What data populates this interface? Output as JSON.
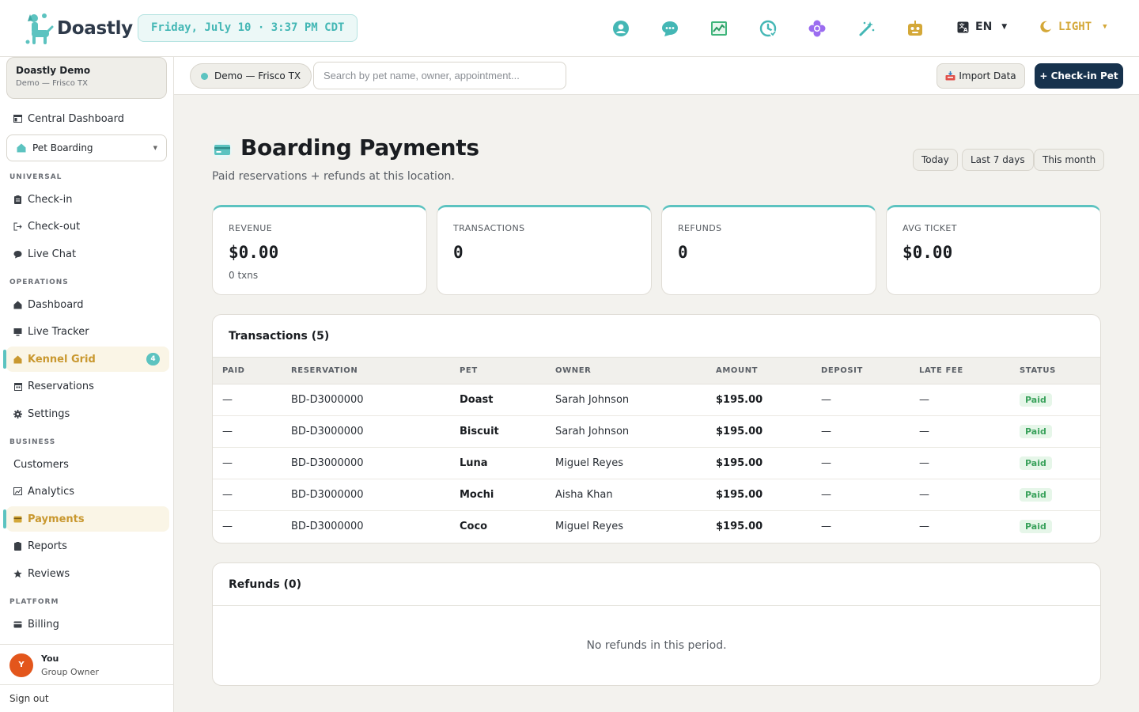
{
  "brand": {
    "name": "Doastly"
  },
  "topbar": {
    "datetime": "Friday, July 10 · 3:37 PM CDT",
    "icons": [
      "support-icon",
      "chat-icon",
      "chart-icon",
      "clock-icon",
      "flower-icon",
      "magic-wand-icon",
      "robot-icon"
    ],
    "language": "EN",
    "theme": "LIGHT"
  },
  "sidebar": {
    "tenant_name": "Doastly Demo",
    "tenant_sub": "Demo — Frisco TX",
    "central_dashboard": "Central Dashboard",
    "vertical_select": "Pet Boarding",
    "sections": {
      "universal": "UNIVERSAL",
      "operations": "OPERATIONS",
      "business": "BUSINESS",
      "platform": "PLATFORM"
    },
    "items": {
      "checkin": "Check-in",
      "checkout": "Check-out",
      "live_chat": "Live Chat",
      "dashboard": "Dashboard",
      "live_tracker": "Live Tracker",
      "kennel_grid": "Kennel Grid",
      "kennel_grid_badge": "4",
      "reservations": "Reservations",
      "settings": "Settings",
      "customers": "Customers",
      "analytics": "Analytics",
      "payments": "Payments",
      "reports": "Reports",
      "reviews": "Reviews",
      "billing": "Billing"
    },
    "user": {
      "initial": "Y",
      "name": "You",
      "role": "Group Owner"
    },
    "sign_out": "Sign out"
  },
  "subbar": {
    "location": "Demo — Frisco TX",
    "search_placeholder": "Search by pet name, owner, appointment...",
    "import_label": "Import Data",
    "checkin_label": "+ Check-in Pet"
  },
  "page": {
    "title": "Boarding Payments",
    "subtitle": "Paid reservations + refunds at this location.",
    "ranges": [
      "Today",
      "Last 7 days",
      "This month"
    ]
  },
  "stats": [
    {
      "label": "REVENUE",
      "value": "$0.00",
      "note": "0 txns"
    },
    {
      "label": "TRANSACTIONS",
      "value": "0",
      "note": ""
    },
    {
      "label": "REFUNDS",
      "value": "0",
      "note": ""
    },
    {
      "label": "AVG TICKET",
      "value": "$0.00",
      "note": ""
    }
  ],
  "transactions": {
    "title": "Transactions (5)",
    "columns": [
      "PAID",
      "RESERVATION",
      "PET",
      "OWNER",
      "AMOUNT",
      "DEPOSIT",
      "LATE FEE",
      "STATUS"
    ],
    "rows": [
      {
        "paid": "—",
        "reservation": "BD-D3000000",
        "pet": "Doast",
        "owner": "Sarah Johnson",
        "amount": "$195.00",
        "deposit": "—",
        "late_fee": "—",
        "status": "Paid"
      },
      {
        "paid": "—",
        "reservation": "BD-D3000000",
        "pet": "Biscuit",
        "owner": "Sarah Johnson",
        "amount": "$195.00",
        "deposit": "—",
        "late_fee": "—",
        "status": "Paid"
      },
      {
        "paid": "—",
        "reservation": "BD-D3000000",
        "pet": "Luna",
        "owner": "Miguel Reyes",
        "amount": "$195.00",
        "deposit": "—",
        "late_fee": "—",
        "status": "Paid"
      },
      {
        "paid": "—",
        "reservation": "BD-D3000000",
        "pet": "Mochi",
        "owner": "Aisha Khan",
        "amount": "$195.00",
        "deposit": "—",
        "late_fee": "—",
        "status": "Paid"
      },
      {
        "paid": "—",
        "reservation": "BD-D3000000",
        "pet": "Coco",
        "owner": "Miguel Reyes",
        "amount": "$195.00",
        "deposit": "—",
        "late_fee": "—",
        "status": "Paid"
      }
    ]
  },
  "refunds": {
    "title": "Refunds (0)",
    "empty": "No refunds in this period."
  },
  "colors": {
    "accent": "#5cc3c0",
    "primary_button": "#17324d",
    "active_nav": "#c9982f",
    "paid_status": "#3aa25c"
  }
}
